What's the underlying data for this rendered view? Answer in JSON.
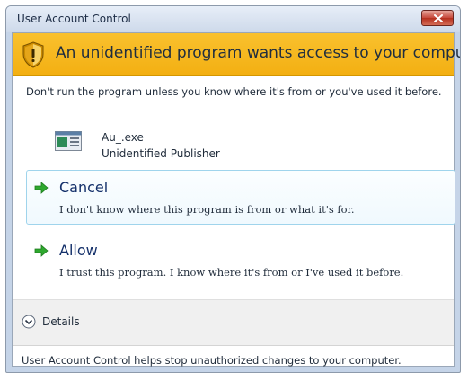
{
  "window": {
    "title": "User Account Control"
  },
  "banner": {
    "icon": "shield-warning-icon",
    "text": "An unidentified program wants access to your computer",
    "color": "#f5b41c"
  },
  "warning": {
    "text": "Don't run the program unless you know where it's from or you've used it before."
  },
  "program": {
    "icon": "program-window-icon",
    "name": "Au_.exe",
    "publisher": "Unidentified Publisher"
  },
  "options": [
    {
      "id": "cancel",
      "icon": "green-arrow-icon",
      "title": "Cancel",
      "description": "I don't know where this program is from or what it's for."
    },
    {
      "id": "allow",
      "icon": "green-arrow-icon",
      "title": "Allow",
      "description": "I trust this program. I know where it's from or I've used it before."
    }
  ],
  "details": {
    "icon": "chevron-down-circle-icon",
    "label": "Details"
  },
  "footer": {
    "text": "User Account Control helps stop unauthorized changes to your computer."
  },
  "colors": {
    "accent_link": "#14306a",
    "selected_border": "#9fd4ec",
    "arrow_green": "#2ea82e"
  }
}
